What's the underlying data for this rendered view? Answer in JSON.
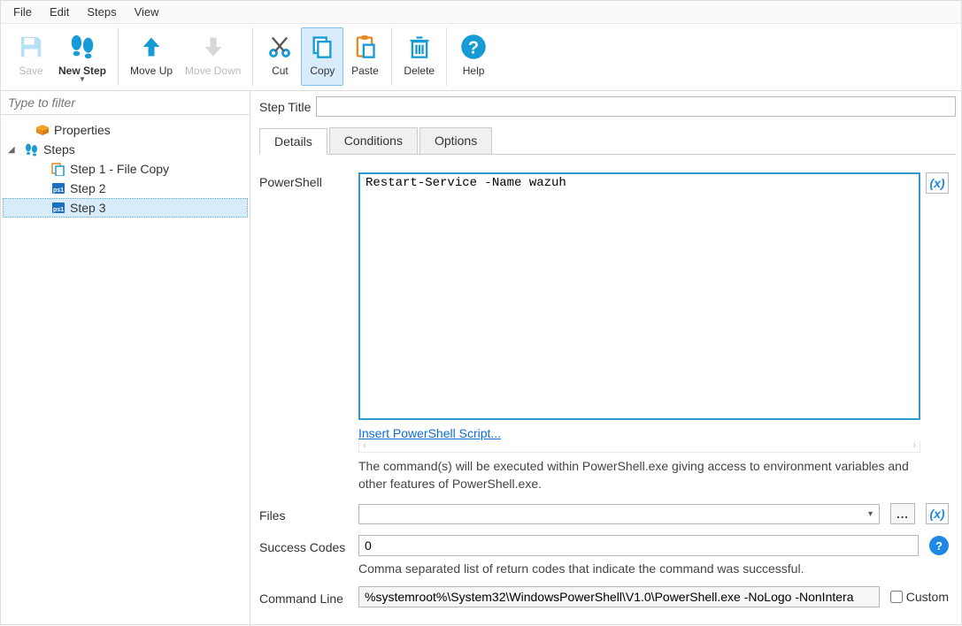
{
  "menu": {
    "file": "File",
    "edit": "Edit",
    "steps": "Steps",
    "view": "View"
  },
  "toolbar": {
    "save": "Save",
    "new_step": "New Step",
    "move_up": "Move Up",
    "move_down": "Move Down",
    "cut": "Cut",
    "copy": "Copy",
    "paste": "Paste",
    "delete": "Delete",
    "help": "Help"
  },
  "filter_placeholder": "Type to filter",
  "tree": {
    "properties": "Properties",
    "steps": "Steps",
    "step1": "Step 1 - File Copy",
    "step2": "Step 2",
    "step3": "Step 3"
  },
  "step_title_label": "Step Title",
  "step_title_value": "",
  "tabs": {
    "details": "Details",
    "conditions": "Conditions",
    "options": "Options"
  },
  "powershell_label": "PowerShell",
  "powershell_script": "Restart-Service -Name wazuh",
  "insert_ps_link": "Insert PowerShell Script...",
  "ps_description": "The command(s) will be executed within PowerShell.exe giving access to environment variables and other features of PowerShell.exe.",
  "files_label": "Files",
  "files_value": "",
  "browse_label": "...",
  "success_codes_label": "Success Codes",
  "success_codes_value": "0",
  "success_codes_hint": "Comma separated list of return codes that indicate the command was successful.",
  "command_line_label": "Command Line",
  "command_line_value": "%systemroot%\\System32\\WindowsPowerShell\\V1.0\\PowerShell.exe -NoLogo -NonIntera",
  "custom_label": "Custom",
  "xvar_label": "(x)"
}
